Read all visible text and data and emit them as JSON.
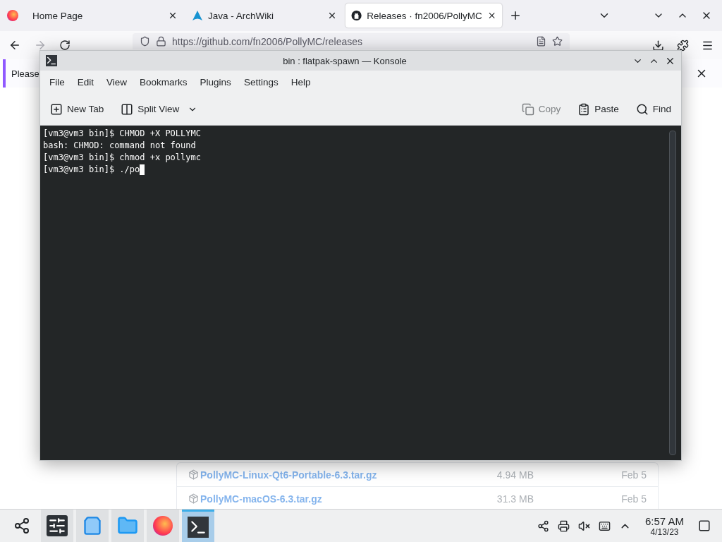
{
  "browser": {
    "tabs": [
      {
        "label": "Home Page",
        "kind": "plain",
        "selected": false
      },
      {
        "label": "Java - ArchWiki",
        "kind": "arch",
        "selected": false
      },
      {
        "label": "Releases · fn2006/PollyMC",
        "kind": "github",
        "selected": true
      }
    ],
    "url": "https://github.com/fn2006/PollyMC/releases",
    "notice": "Please",
    "assets": [
      {
        "name": "PollyMC-Linux-Qt6-Portable-6.3.tar.gz",
        "size": "4.94 MB",
        "date": "Feb 5"
      },
      {
        "name": "PollyMC-macOS-6.3.tar.gz",
        "size": "31.3 MB",
        "date": "Feb 5"
      }
    ]
  },
  "konsole": {
    "title": "bin : flatpak-spawn — Konsole",
    "menu": [
      "File",
      "Edit",
      "View",
      "Bookmarks",
      "Plugins",
      "Settings",
      "Help"
    ],
    "toolbar_left": [
      {
        "label": "New Tab",
        "kind": "newtab",
        "disabled": false
      },
      {
        "label": "Split View",
        "kind": "split",
        "disabled": false
      }
    ],
    "toolbar_right": [
      {
        "label": "Copy",
        "kind": "copy",
        "disabled": true
      },
      {
        "label": "Paste",
        "kind": "paste",
        "disabled": false
      },
      {
        "label": "Find",
        "kind": "find",
        "disabled": false
      }
    ],
    "lines": [
      "[vm3@vm3 bin]$ CHMOD +X POLLYMC",
      "bash: CHMOD: command not found",
      "[vm3@vm3 bin]$ chmod +x pollymc",
      "[vm3@vm3 bin]$ ./po"
    ]
  },
  "taskbar": {
    "apps": [
      {
        "kind": "settings",
        "selected": false
      },
      {
        "kind": "discover",
        "selected": false
      },
      {
        "kind": "files",
        "selected": false
      },
      {
        "kind": "firefox",
        "selected": false
      },
      {
        "kind": "terminal",
        "selected": true
      }
    ],
    "time": "6:57 AM",
    "date": "4/13/23"
  }
}
